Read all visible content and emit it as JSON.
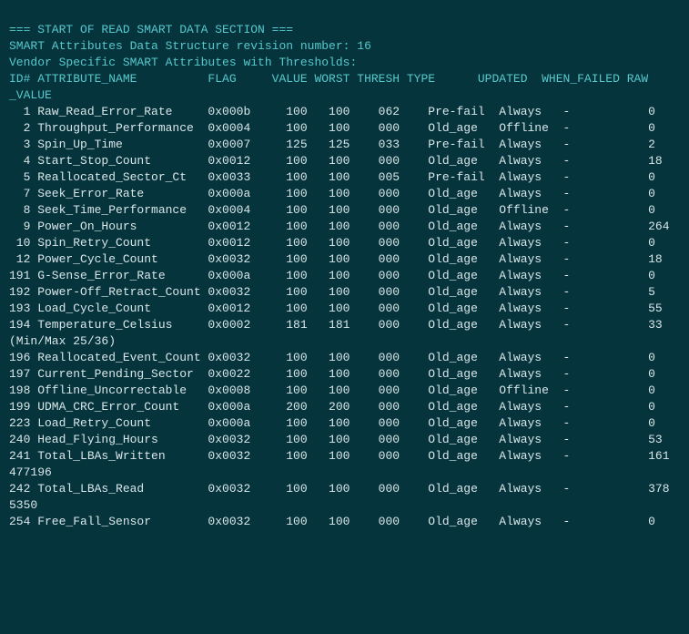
{
  "header": {
    "section": "=== START OF READ SMART DATA SECTION ===",
    "revision": "SMART Attributes Data Structure revision number: 16",
    "vendor": "Vendor Specific SMART Attributes with Thresholds:",
    "columns_line1": "ID# ATTRIBUTE_NAME          FLAG     VALUE WORST THRESH TYPE      UPDATED  WHEN_FAILED RAW",
    "columns_line2": "_VALUE"
  },
  "columns": [
    "ID#",
    "ATTRIBUTE_NAME",
    "FLAG",
    "VALUE",
    "WORST",
    "THRESH",
    "TYPE",
    "UPDATED",
    "WHEN_FAILED",
    "RAW_VALUE"
  ],
  "attributes": [
    {
      "id": 1,
      "name": "Raw_Read_Error_Rate",
      "flag": "0x000b",
      "value": "100",
      "worst": "100",
      "thresh": "062",
      "type": "Pre-fail",
      "updated": "Always",
      "when_failed": "-",
      "raw": "0"
    },
    {
      "id": 2,
      "name": "Throughput_Performance",
      "flag": "0x0004",
      "value": "100",
      "worst": "100",
      "thresh": "000",
      "type": "Old_age",
      "updated": "Offline",
      "when_failed": "-",
      "raw": "0"
    },
    {
      "id": 3,
      "name": "Spin_Up_Time",
      "flag": "0x0007",
      "value": "125",
      "worst": "125",
      "thresh": "033",
      "type": "Pre-fail",
      "updated": "Always",
      "when_failed": "-",
      "raw": "2"
    },
    {
      "id": 4,
      "name": "Start_Stop_Count",
      "flag": "0x0012",
      "value": "100",
      "worst": "100",
      "thresh": "000",
      "type": "Old_age",
      "updated": "Always",
      "when_failed": "-",
      "raw": "18"
    },
    {
      "id": 5,
      "name": "Reallocated_Sector_Ct",
      "flag": "0x0033",
      "value": "100",
      "worst": "100",
      "thresh": "005",
      "type": "Pre-fail",
      "updated": "Always",
      "when_failed": "-",
      "raw": "0"
    },
    {
      "id": 7,
      "name": "Seek_Error_Rate",
      "flag": "0x000a",
      "value": "100",
      "worst": "100",
      "thresh": "000",
      "type": "Old_age",
      "updated": "Always",
      "when_failed": "-",
      "raw": "0"
    },
    {
      "id": 8,
      "name": "Seek_Time_Performance",
      "flag": "0x0004",
      "value": "100",
      "worst": "100",
      "thresh": "000",
      "type": "Old_age",
      "updated": "Offline",
      "when_failed": "-",
      "raw": "0"
    },
    {
      "id": 9,
      "name": "Power_On_Hours",
      "flag": "0x0012",
      "value": "100",
      "worst": "100",
      "thresh": "000",
      "type": "Old_age",
      "updated": "Always",
      "when_failed": "-",
      "raw": "264"
    },
    {
      "id": 10,
      "name": "Spin_Retry_Count",
      "flag": "0x0012",
      "value": "100",
      "worst": "100",
      "thresh": "000",
      "type": "Old_age",
      "updated": "Always",
      "when_failed": "-",
      "raw": "0"
    },
    {
      "id": 12,
      "name": "Power_Cycle_Count",
      "flag": "0x0032",
      "value": "100",
      "worst": "100",
      "thresh": "000",
      "type": "Old_age",
      "updated": "Always",
      "when_failed": "-",
      "raw": "18"
    },
    {
      "id": 191,
      "name": "G-Sense_Error_Rate",
      "flag": "0x000a",
      "value": "100",
      "worst": "100",
      "thresh": "000",
      "type": "Old_age",
      "updated": "Always",
      "when_failed": "-",
      "raw": "0"
    },
    {
      "id": 192,
      "name": "Power-Off_Retract_Count",
      "flag": "0x0032",
      "value": "100",
      "worst": "100",
      "thresh": "000",
      "type": "Old_age",
      "updated": "Always",
      "when_failed": "-",
      "raw": "5"
    },
    {
      "id": 193,
      "name": "Load_Cycle_Count",
      "flag": "0x0012",
      "value": "100",
      "worst": "100",
      "thresh": "000",
      "type": "Old_age",
      "updated": "Always",
      "when_failed": "-",
      "raw": "55"
    },
    {
      "id": 194,
      "name": "Temperature_Celsius",
      "flag": "0x0002",
      "value": "181",
      "worst": "181",
      "thresh": "000",
      "type": "Old_age",
      "updated": "Always",
      "when_failed": "-",
      "raw": "33",
      "raw_extra": "(Min/Max 25/36)"
    },
    {
      "id": 196,
      "name": "Reallocated_Event_Count",
      "flag": "0x0032",
      "value": "100",
      "worst": "100",
      "thresh": "000",
      "type": "Old_age",
      "updated": "Always",
      "when_failed": "-",
      "raw": "0"
    },
    {
      "id": 197,
      "name": "Current_Pending_Sector",
      "flag": "0x0022",
      "value": "100",
      "worst": "100",
      "thresh": "000",
      "type": "Old_age",
      "updated": "Always",
      "when_failed": "-",
      "raw": "0"
    },
    {
      "id": 198,
      "name": "Offline_Uncorrectable",
      "flag": "0x0008",
      "value": "100",
      "worst": "100",
      "thresh": "000",
      "type": "Old_age",
      "updated": "Offline",
      "when_failed": "-",
      "raw": "0"
    },
    {
      "id": 199,
      "name": "UDMA_CRC_Error_Count",
      "flag": "0x000a",
      "value": "200",
      "worst": "200",
      "thresh": "000",
      "type": "Old_age",
      "updated": "Always",
      "when_failed": "-",
      "raw": "0"
    },
    {
      "id": 223,
      "name": "Load_Retry_Count",
      "flag": "0x000a",
      "value": "100",
      "worst": "100",
      "thresh": "000",
      "type": "Old_age",
      "updated": "Always",
      "when_failed": "-",
      "raw": "0"
    },
    {
      "id": 240,
      "name": "Head_Flying_Hours",
      "flag": "0x0032",
      "value": "100",
      "worst": "100",
      "thresh": "000",
      "type": "Old_age",
      "updated": "Always",
      "when_failed": "-",
      "raw": "53"
    },
    {
      "id": 241,
      "name": "Total_LBAs_Written",
      "flag": "0x0032",
      "value": "100",
      "worst": "100",
      "thresh": "000",
      "type": "Old_age",
      "updated": "Always",
      "when_failed": "-",
      "raw": "161",
      "raw_extra": "477196"
    },
    {
      "id": 242,
      "name": "Total_LBAs_Read",
      "flag": "0x0032",
      "value": "100",
      "worst": "100",
      "thresh": "000",
      "type": "Old_age",
      "updated": "Always",
      "when_failed": "-",
      "raw": "378",
      "raw_extra": "5350"
    },
    {
      "id": 254,
      "name": "Free_Fall_Sensor",
      "flag": "0x0032",
      "value": "100",
      "worst": "100",
      "thresh": "000",
      "type": "Old_age",
      "updated": "Always",
      "when_failed": "-",
      "raw": "0"
    }
  ]
}
